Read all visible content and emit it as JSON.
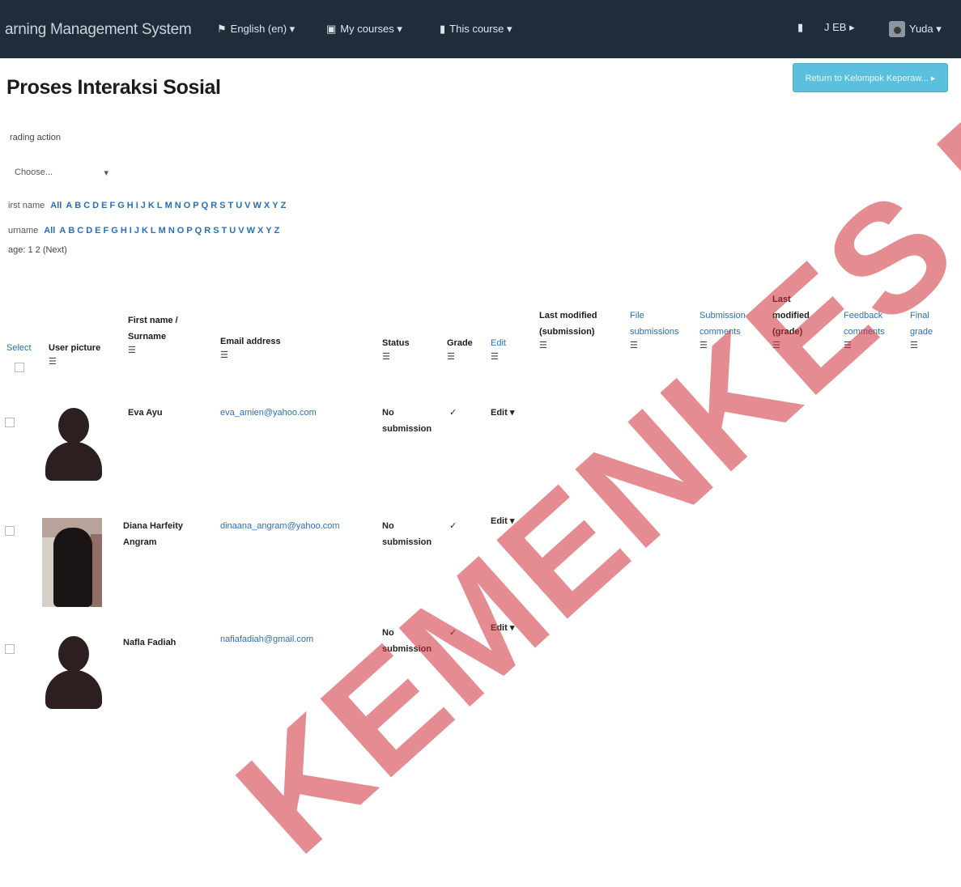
{
  "topbar": {
    "brand": "arning Management System",
    "menu": [
      {
        "label": "English (en) ▾"
      },
      {
        "label": "My courses ▾"
      },
      {
        "label": "This course ▾"
      }
    ],
    "messages": "J EB ▸",
    "user": "Yuda ▾"
  },
  "page": {
    "title": "Proses Interaksi Sosial",
    "action_button": "Return to Kelompok Keperaw... ▸"
  },
  "grading": {
    "action_label": "rading action",
    "select_value": "Choose...",
    "firstname_label": "irst name",
    "surname_label": "urname",
    "all_label": "All",
    "letters": [
      "A",
      "B",
      "C",
      "D",
      "E",
      "F",
      "G",
      "H",
      "I",
      "J",
      "K",
      "L",
      "M",
      "N",
      "O",
      "P",
      "Q",
      "R",
      "S",
      "T",
      "U",
      "V",
      "W",
      "X",
      "Y",
      "Z"
    ],
    "page_label": "age: 1 2 (Next)"
  },
  "table": {
    "headers": {
      "select": "Select",
      "user_picture": "User picture",
      "first_name": "First name / Surname",
      "email": "Email address",
      "status": "Status",
      "grade": "Grade",
      "edit": "Edit",
      "last_modified_submission": "Last modified (submission)",
      "file_submissions": "File submissions",
      "submission_comments": "Submission comments",
      "last_modified_grade": "Last modified (grade)",
      "feedback_comments": "Feedback comments",
      "final_grade": "Final grade"
    },
    "sort_icon": "☰",
    "rows": [
      {
        "name": "Eva Ayu",
        "email": "eva_amien@yahoo.com",
        "status": "No submission",
        "grade": "✓",
        "edit": "Edit ▾"
      },
      {
        "name": "Diana Harfeity Angram",
        "email": "dinaana_angram@yahoo.com",
        "status": "No submission",
        "grade": "✓",
        "edit": "Edit ▾"
      },
      {
        "name": "Nafla Fadiah",
        "email": "nafiafadiah@gmail.com",
        "status": "No submission",
        "grade": "✓",
        "edit": "Edit ▾"
      }
    ]
  },
  "watermark": "KEMENKES RI"
}
